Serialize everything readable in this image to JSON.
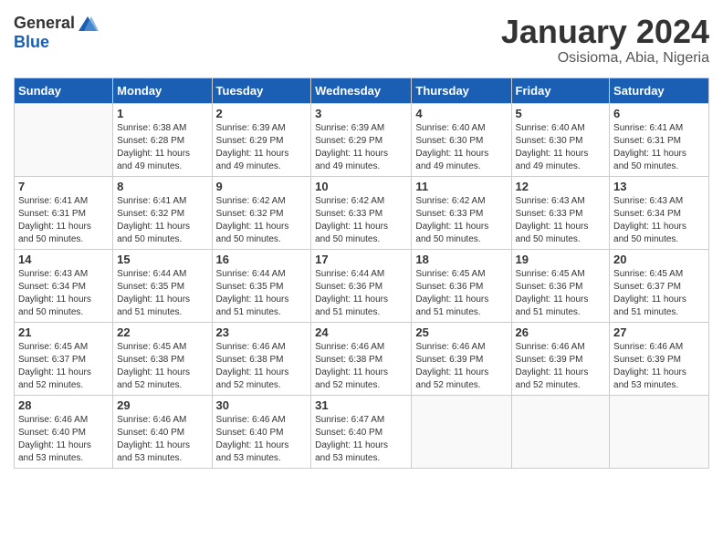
{
  "header": {
    "logo": {
      "general": "General",
      "blue": "Blue"
    },
    "title": "January 2024",
    "subtitle": "Osisioma, Abia, Nigeria"
  },
  "weekdays": [
    "Sunday",
    "Monday",
    "Tuesday",
    "Wednesday",
    "Thursday",
    "Friday",
    "Saturday"
  ],
  "weeks": [
    [
      {
        "day": "",
        "info": ""
      },
      {
        "day": "1",
        "info": "Sunrise: 6:38 AM\nSunset: 6:28 PM\nDaylight: 11 hours\nand 49 minutes."
      },
      {
        "day": "2",
        "info": "Sunrise: 6:39 AM\nSunset: 6:29 PM\nDaylight: 11 hours\nand 49 minutes."
      },
      {
        "day": "3",
        "info": "Sunrise: 6:39 AM\nSunset: 6:29 PM\nDaylight: 11 hours\nand 49 minutes."
      },
      {
        "day": "4",
        "info": "Sunrise: 6:40 AM\nSunset: 6:30 PM\nDaylight: 11 hours\nand 49 minutes."
      },
      {
        "day": "5",
        "info": "Sunrise: 6:40 AM\nSunset: 6:30 PM\nDaylight: 11 hours\nand 49 minutes."
      },
      {
        "day": "6",
        "info": "Sunrise: 6:41 AM\nSunset: 6:31 PM\nDaylight: 11 hours\nand 50 minutes."
      }
    ],
    [
      {
        "day": "7",
        "info": "Sunrise: 6:41 AM\nSunset: 6:31 PM\nDaylight: 11 hours\nand 50 minutes."
      },
      {
        "day": "8",
        "info": "Sunrise: 6:41 AM\nSunset: 6:32 PM\nDaylight: 11 hours\nand 50 minutes."
      },
      {
        "day": "9",
        "info": "Sunrise: 6:42 AM\nSunset: 6:32 PM\nDaylight: 11 hours\nand 50 minutes."
      },
      {
        "day": "10",
        "info": "Sunrise: 6:42 AM\nSunset: 6:33 PM\nDaylight: 11 hours\nand 50 minutes."
      },
      {
        "day": "11",
        "info": "Sunrise: 6:42 AM\nSunset: 6:33 PM\nDaylight: 11 hours\nand 50 minutes."
      },
      {
        "day": "12",
        "info": "Sunrise: 6:43 AM\nSunset: 6:33 PM\nDaylight: 11 hours\nand 50 minutes."
      },
      {
        "day": "13",
        "info": "Sunrise: 6:43 AM\nSunset: 6:34 PM\nDaylight: 11 hours\nand 50 minutes."
      }
    ],
    [
      {
        "day": "14",
        "info": "Sunrise: 6:43 AM\nSunset: 6:34 PM\nDaylight: 11 hours\nand 50 minutes."
      },
      {
        "day": "15",
        "info": "Sunrise: 6:44 AM\nSunset: 6:35 PM\nDaylight: 11 hours\nand 51 minutes."
      },
      {
        "day": "16",
        "info": "Sunrise: 6:44 AM\nSunset: 6:35 PM\nDaylight: 11 hours\nand 51 minutes."
      },
      {
        "day": "17",
        "info": "Sunrise: 6:44 AM\nSunset: 6:36 PM\nDaylight: 11 hours\nand 51 minutes."
      },
      {
        "day": "18",
        "info": "Sunrise: 6:45 AM\nSunset: 6:36 PM\nDaylight: 11 hours\nand 51 minutes."
      },
      {
        "day": "19",
        "info": "Sunrise: 6:45 AM\nSunset: 6:36 PM\nDaylight: 11 hours\nand 51 minutes."
      },
      {
        "day": "20",
        "info": "Sunrise: 6:45 AM\nSunset: 6:37 PM\nDaylight: 11 hours\nand 51 minutes."
      }
    ],
    [
      {
        "day": "21",
        "info": "Sunrise: 6:45 AM\nSunset: 6:37 PM\nDaylight: 11 hours\nand 52 minutes."
      },
      {
        "day": "22",
        "info": "Sunrise: 6:45 AM\nSunset: 6:38 PM\nDaylight: 11 hours\nand 52 minutes."
      },
      {
        "day": "23",
        "info": "Sunrise: 6:46 AM\nSunset: 6:38 PM\nDaylight: 11 hours\nand 52 minutes."
      },
      {
        "day": "24",
        "info": "Sunrise: 6:46 AM\nSunset: 6:38 PM\nDaylight: 11 hours\nand 52 minutes."
      },
      {
        "day": "25",
        "info": "Sunrise: 6:46 AM\nSunset: 6:39 PM\nDaylight: 11 hours\nand 52 minutes."
      },
      {
        "day": "26",
        "info": "Sunrise: 6:46 AM\nSunset: 6:39 PM\nDaylight: 11 hours\nand 52 minutes."
      },
      {
        "day": "27",
        "info": "Sunrise: 6:46 AM\nSunset: 6:39 PM\nDaylight: 11 hours\nand 53 minutes."
      }
    ],
    [
      {
        "day": "28",
        "info": "Sunrise: 6:46 AM\nSunset: 6:40 PM\nDaylight: 11 hours\nand 53 minutes."
      },
      {
        "day": "29",
        "info": "Sunrise: 6:46 AM\nSunset: 6:40 PM\nDaylight: 11 hours\nand 53 minutes."
      },
      {
        "day": "30",
        "info": "Sunrise: 6:46 AM\nSunset: 6:40 PM\nDaylight: 11 hours\nand 53 minutes."
      },
      {
        "day": "31",
        "info": "Sunrise: 6:47 AM\nSunset: 6:40 PM\nDaylight: 11 hours\nand 53 minutes."
      },
      {
        "day": "",
        "info": ""
      },
      {
        "day": "",
        "info": ""
      },
      {
        "day": "",
        "info": ""
      }
    ]
  ]
}
